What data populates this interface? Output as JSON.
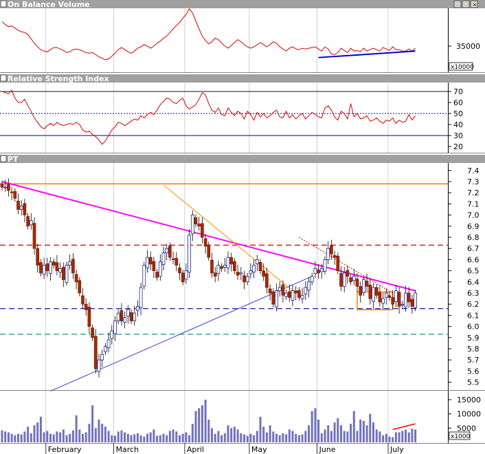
{
  "chart_data": {
    "type": "candlestick",
    "x_axis": {
      "months": [
        "February",
        "March",
        "April",
        "May",
        "June",
        "July"
      ]
    },
    "panels": [
      {
        "id": "obv",
        "title": "On Balance Volume",
        "tick_labels": [
          "35000"
        ],
        "multiplier_label": "x10000",
        "series_color": "#d40000",
        "trendline_color": "#0000cc",
        "values": [
          38400,
          38000,
          37700,
          37800,
          37500,
          37200,
          37000,
          36900,
          36600,
          36000,
          35400,
          34900,
          34500,
          34300,
          34200,
          34500,
          34800,
          34800,
          34600,
          34400,
          34100,
          34200,
          34500,
          34600,
          34500,
          34300,
          34100,
          34000,
          34100,
          33800,
          33500,
          33300,
          33100,
          33200,
          33600,
          34000,
          34500,
          34800,
          34500,
          34200,
          34000,
          34300,
          34700,
          34900,
          35200,
          35000,
          34700,
          35000,
          35400,
          35700,
          36100,
          36400,
          36900,
          37400,
          37900,
          38300,
          38900,
          39400,
          40200,
          39600,
          38500,
          37400,
          36400,
          35800,
          35300,
          35600,
          36100,
          35900,
          35400,
          35000,
          34700,
          35100,
          35500,
          35900,
          35600,
          35200,
          34900,
          34700,
          34900,
          35200,
          35500,
          35200,
          34900,
          35200,
          35600,
          35400,
          34900,
          34600,
          34300,
          34700,
          34900,
          34600,
          34500,
          34700,
          34600,
          34700,
          34800,
          34900,
          34600,
          34300,
          34900,
          34600,
          33900,
          33800,
          34100,
          34700,
          34400,
          34100,
          34700,
          34300,
          34400,
          34200,
          34700,
          34300,
          34500,
          34700,
          34500,
          34300,
          34800,
          34600,
          34400,
          34900,
          34500,
          34500,
          34300,
          34300,
          34600,
          34300,
          34700
        ]
      },
      {
        "id": "rsi",
        "title": "Relative Strength Index",
        "tick_labels": [
          "70",
          "60",
          "50",
          "40",
          "30",
          "20"
        ],
        "ylim": [
          15,
          75
        ],
        "overbought": 70,
        "midline": 50,
        "oversold": 30,
        "series_color": "#d40000",
        "values": [
          70,
          69,
          68,
          71,
          64,
          60,
          60,
          63,
          57,
          52,
          46,
          42,
          38,
          36,
          39,
          41,
          39,
          42,
          40,
          39,
          40,
          41,
          40,
          42,
          40,
          35,
          33,
          34,
          31,
          29,
          26,
          22,
          25,
          30,
          35,
          38,
          42,
          41,
          39,
          41,
          43,
          45,
          44,
          48,
          46,
          49,
          51,
          49,
          53,
          58,
          61,
          64,
          63,
          60,
          59,
          62,
          64,
          57,
          54,
          56,
          58,
          63,
          69,
          67,
          59,
          53,
          51,
          55,
          49,
          48,
          55,
          51,
          48,
          52,
          50,
          45,
          52,
          49,
          44,
          51,
          47,
          50,
          46,
          48,
          51,
          53,
          47,
          46,
          52,
          46,
          49,
          45,
          48,
          50,
          45,
          48,
          51,
          49,
          47,
          46,
          55,
          57,
          53,
          47,
          44,
          52,
          50,
          45,
          59,
          47,
          50,
          45,
          46,
          48,
          43,
          44,
          46,
          43,
          41,
          44,
          43,
          46,
          41,
          44,
          42,
          43,
          49,
          44,
          48
        ]
      },
      {
        "id": "price",
        "title": "PT",
        "tick_labels": [
          "7.4",
          "7.3",
          "7.2",
          "7.1",
          "7.0",
          "6.9",
          "6.8",
          "6.7",
          "6.6",
          "6.5",
          "6.4",
          "6.3",
          "6.2",
          "6.1",
          "6.0",
          "5.9",
          "5.8",
          "5.7",
          "5.6",
          "5.5"
        ],
        "ylim": [
          5.4,
          7.5
        ],
        "up_color": "#ffffff",
        "down_color": "#a52a00",
        "close": [
          7.25,
          7.25,
          7.22,
          7.2,
          7.15,
          7.05,
          7.08,
          7.0,
          6.9,
          6.95,
          6.7,
          6.55,
          6.48,
          6.55,
          6.5,
          6.58,
          6.55,
          6.5,
          6.52,
          6.42,
          6.55,
          6.58,
          6.48,
          6.4,
          6.3,
          6.2,
          6.15,
          6.0,
          5.9,
          5.62,
          5.7,
          5.75,
          5.82,
          5.88,
          5.96,
          6.05,
          6.12,
          6.05,
          6.08,
          6.15,
          6.05,
          6.12,
          6.18,
          6.35,
          6.55,
          6.62,
          6.56,
          6.5,
          6.44,
          6.58,
          6.66,
          6.7,
          6.62,
          6.6,
          6.55,
          6.48,
          6.4,
          6.5,
          6.82,
          7.0,
          6.92,
          6.9,
          6.8,
          6.72,
          6.62,
          6.48,
          6.45,
          6.55,
          6.52,
          6.55,
          6.62,
          6.56,
          6.5,
          6.46,
          6.48,
          6.4,
          6.45,
          6.5,
          6.55,
          6.6,
          6.5,
          6.45,
          6.35,
          6.3,
          6.2,
          6.32,
          6.35,
          6.28,
          6.3,
          6.26,
          6.32,
          6.3,
          6.26,
          6.28,
          6.35,
          6.4,
          6.45,
          6.52,
          6.48,
          6.52,
          6.6,
          6.7,
          6.65,
          6.62,
          6.5,
          6.36,
          6.48,
          6.45,
          6.4,
          6.45,
          6.36,
          6.28,
          6.42,
          6.36,
          6.25,
          6.35,
          6.28,
          6.22,
          6.25,
          6.3,
          6.26,
          6.2,
          6.32,
          6.18,
          6.2,
          6.3,
          6.22,
          6.18,
          6.3
        ],
        "annotations": {
          "horizontal_levels": [
            {
              "value": 7.28,
              "color": "#ff7a00",
              "style": "solid"
            },
            {
              "value": 6.73,
              "color": "#cc0000",
              "style": "dashed"
            },
            {
              "value": 6.16,
              "color": "#000080",
              "style": "dashed"
            },
            {
              "value": 5.93,
              "color": "#008080",
              "style": "dashed"
            }
          ],
          "trendlines": [
            {
              "color": "#ff00ff",
              "from": [
                0,
                7.3
              ],
              "to": [
                128,
                6.32
              ]
            },
            {
              "color": "#3a3ae0",
              "from": [
                15,
                5.42
              ],
              "to": [
                96,
                6.45
              ]
            },
            {
              "color": "#ff8c00",
              "from": [
                50,
                7.27
              ],
              "to": [
                90,
                6.32
              ]
            },
            {
              "color": "#cc0000",
              "from": [
                92,
                6.8
              ],
              "to": [
                121,
                6.3
              ]
            }
          ],
          "range_box": {
            "from": 110,
            "to": 121,
            "top": 6.31,
            "bottom": 6.15,
            "color": "#ff7a00"
          }
        }
      },
      {
        "id": "volume",
        "title": "",
        "tick_labels": [
          "15000",
          "10000",
          "5000"
        ],
        "multiplier_label": "x1000",
        "ylim": [
          0,
          17000
        ],
        "bar_color": "#7070c0",
        "trendline_color": "#ff0000",
        "values": [
          4200,
          3800,
          3500,
          3000,
          2500,
          3000,
          2800,
          3800,
          5500,
          3200,
          6000,
          7000,
          9000,
          3500,
          4000,
          3000,
          2800,
          3800,
          3500,
          4500,
          2500,
          3000,
          4200,
          9500,
          4500,
          3000,
          3500,
          6500,
          13000,
          5000,
          8000,
          6500,
          5500,
          4000,
          2500,
          2300,
          3800,
          4200,
          3500,
          3000,
          2500,
          2800,
          3200,
          2500,
          2000,
          3000,
          3500,
          4500,
          2300,
          2500,
          3000,
          2500,
          4000,
          4500,
          3800,
          2500,
          3000,
          3500,
          2500,
          6500,
          11000,
          12000,
          13000,
          15000,
          8000,
          5000,
          3000,
          4000,
          2500,
          3200,
          6000,
          5000,
          5500,
          4500,
          3200,
          2800,
          2300,
          3000,
          2500,
          4000,
          9000,
          5500,
          3500,
          6000,
          3800,
          3000,
          2500,
          3200,
          2800,
          4500,
          4000,
          3000,
          2500,
          2800,
          4000,
          6000,
          11000,
          12000,
          8000,
          3200,
          4500,
          6000,
          4000,
          7000,
          8500,
          6000,
          4000,
          3800,
          6500,
          11000,
          4000,
          8000,
          7500,
          6000,
          10000,
          7000,
          4500,
          3800,
          2500,
          3000,
          2000,
          1800,
          3500,
          3500,
          4000,
          4500,
          3500,
          4800,
          4500
        ]
      }
    ]
  }
}
